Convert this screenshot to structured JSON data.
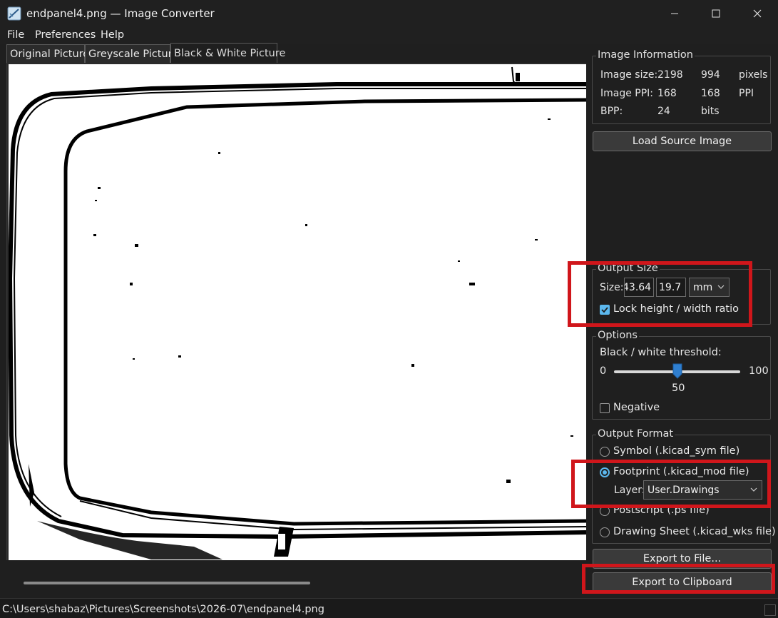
{
  "window": {
    "title": "endpanel4.png — Image Converter"
  },
  "menu": {
    "file": "File",
    "preferences": "Preferences",
    "help": "Help"
  },
  "tabs": {
    "original": "Original Picture",
    "greyscale": "Greyscale Picture",
    "bw": "Black & White Picture",
    "active": "bw"
  },
  "image_info": {
    "title": "Image Information",
    "size_label": "Image size:",
    "size_w": "2198",
    "size_h": "994",
    "size_unit": "pixels",
    "ppi_label": "Image PPI:",
    "ppi_x": "168",
    "ppi_y": "168",
    "ppi_unit": "PPI",
    "bpp_label": "BPP:",
    "bpp_value": "24",
    "bpp_unit": "bits"
  },
  "load_button": "Load Source Image",
  "output_size": {
    "title": "Output Size",
    "size_label": "Size:",
    "width_value": "43.64",
    "height_value": "19.7",
    "unit": "mm",
    "lock_label": "Lock height / width ratio",
    "lock_checked": true
  },
  "options": {
    "title": "Options",
    "threshold_label": "Black / white threshold:",
    "min": "0",
    "max": "100",
    "value": "50",
    "value_fraction": 0.5,
    "negative_label": "Negative",
    "negative_checked": false
  },
  "output_format": {
    "title": "Output Format",
    "symbol": "Symbol (.kicad_sym file)",
    "footprint": "Footprint (.kicad_mod file)",
    "layer_label": "Layer:",
    "layer_value": "User.Drawings",
    "postscript": "Postscript (.ps file)",
    "drawing_sheet": "Drawing Sheet (.kicad_wks file)",
    "selected": "footprint"
  },
  "export_file_button": "Export to File...",
  "export_clipboard_button": "Export to Clipboard",
  "status": {
    "path": "C:\\Users\\shabaz\\Pictures\\Screenshots\\2026-07\\endpanel4.png"
  },
  "colors": {
    "accent": "#5cb8ee",
    "highlight": "#d0161b",
    "background": "#1f1f1f"
  }
}
